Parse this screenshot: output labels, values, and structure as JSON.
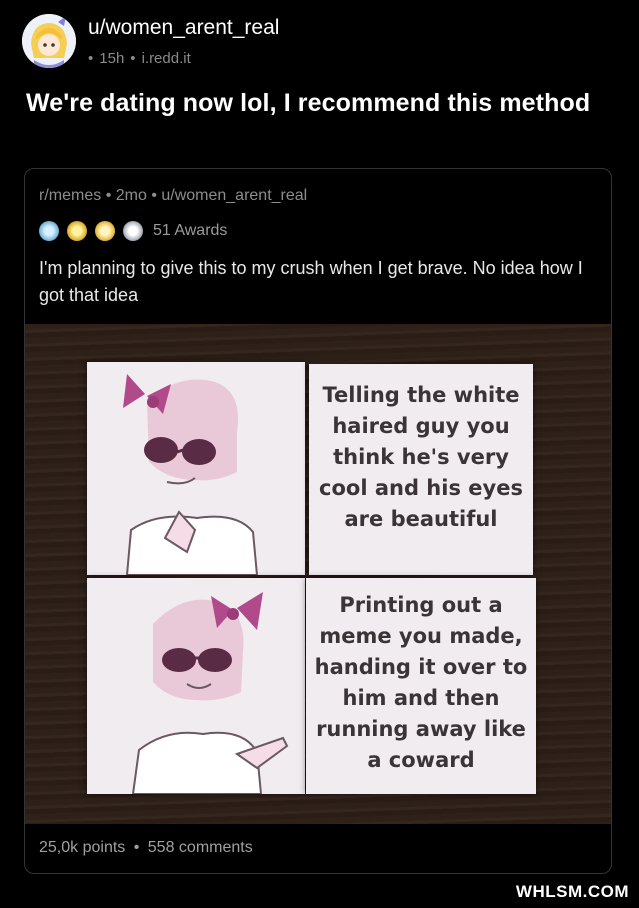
{
  "post": {
    "username": "u/women_arent_real",
    "age": "15h",
    "domain": "i.redd.it",
    "title": "We're dating now lol, I recommend this method"
  },
  "crosspost": {
    "subreddit": "r/memes",
    "age": "2mo",
    "author": "u/women_arent_real",
    "awards_label": "51 Awards",
    "text": "I'm planning to give this to my crush when I get brave. No idea how I got that idea",
    "meme": {
      "top_caption": "Telling the white haired guy you think he's very cool and his eyes are beautiful",
      "bottom_caption": "Printing out a meme you made, handing it over to him and then running away like a coward"
    },
    "points": "25,0k points",
    "comments": "558 comments"
  },
  "watermark": "WHLSM.COM",
  "colors": {
    "background": "#000000",
    "meta_text": "#8a8a8a",
    "border": "#343434",
    "bow": "#b04a8a",
    "hair": "#e7c4d8"
  }
}
